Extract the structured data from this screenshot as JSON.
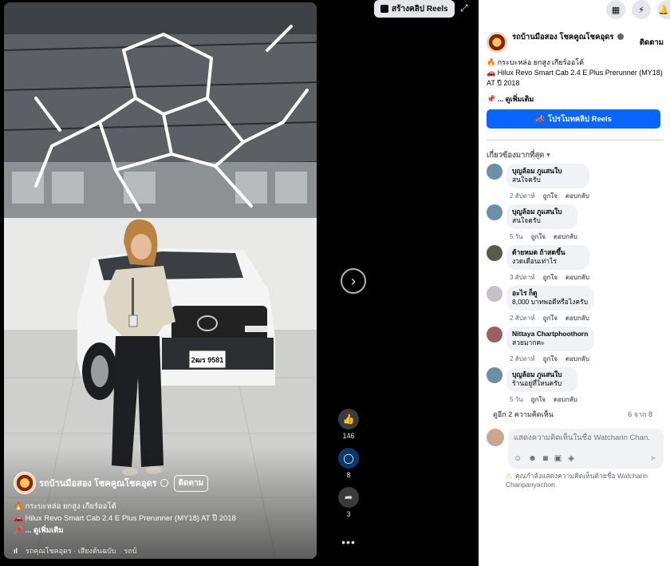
{
  "viewer": {
    "create_reels_label": "สร้างคลิป Reels",
    "video": {
      "author_name": "รถบ้านมือสอง โชคคูณโชคอุดร",
      "follow_label": "ติดตาม",
      "caption_line1": "🔥 กระบะหล่อ ยกสูง เกียร์ออโต้",
      "caption_line2": "🚗 Hilux Revo Smart Cab 2.4 E Plus Prerunner (MY18) AT ปี 2018",
      "see_more": "📌 ... ดูเพิ่มเติม",
      "audio_text": "รถคุณโชคอุดร · เสียงต้นฉบับ",
      "audio_tail": "รถบ้",
      "plate_text": "2ฒร 9581"
    },
    "actions": {
      "likes": "146",
      "comments": "8",
      "shares": "3"
    }
  },
  "panel": {
    "page_name": "รถบ้านมือสอง โชคคูณโชคอุดร",
    "follow_label": "ติดตาม",
    "desc_line1": "🔥 กระบะหล่อ ยกสูง เกียร์ออโต้",
    "desc_line2": "🚗 Hilux Revo Smart Cab 2.4 E Plus Prerunner (MY18) AT ปี 2018",
    "see_more": "📌 ... ดูเพิ่มเติม",
    "promote_label": "โปรโมทคลิป Reels",
    "sort_label": "เกี่ยวข้องมากที่สุด",
    "comments": [
      {
        "author": "บุญล้อม ภูแสนใบ",
        "text": "สนใจครับ",
        "time": "2 สัปดาห์",
        "like": "ถูกใจ",
        "reply": "ตอบกลับ",
        "avatar_color": "#6b8fa8"
      },
      {
        "author": "บุญล้อม ภูแสนใบ",
        "text": "สนใจครับ",
        "time": "5 วัน",
        "like": "ถูกใจ",
        "reply": "ตอบกลับ",
        "avatar_color": "#6b8fa8"
      },
      {
        "author": "ด้ายหมด ถ้าสดขึ้น",
        "text": "งวดเดือนเท่าไร",
        "time": "3 สัปดาห์",
        "like": "ถูกใจ",
        "reply": "ตอบกลับ",
        "avatar_color": "#5a5a4a"
      },
      {
        "author": "อะไร ก็ดู",
        "text": "8,000 บาทพอดีหรือไงครับ",
        "time": "2 สัปดาห์",
        "like": "ถูกใจ",
        "reply": "ตอบกลับ",
        "avatar_color": "#c7c0c8"
      },
      {
        "author": "Nittaya Chartphoothorn",
        "text": "สวยมากคะ",
        "time": "2 สัปดาห์",
        "like": "ถูกใจ",
        "reply": "ตอบกลับ",
        "avatar_color": "#9b5f62"
      },
      {
        "author": "บุญล้อม ภูแสนใบ",
        "text": "ร้านอยู่ที่ไหนครับ",
        "time": "5 วัน",
        "like": "ถูกใจ",
        "reply": "ตอบกลับ",
        "avatar_color": "#6b8fa8"
      }
    ],
    "more_comments": "ดูอีก 2 ความคิดเห็น",
    "comment_count": "6 จาก 8",
    "input_placeholder": "แสดงความคิดเห็นในชื่อ Watcharin Chan...",
    "warning": "คุณกำลังแสดงความคิดเห็นด้วยชื่อ Watcharin Chanpanyachon"
  },
  "colors": {
    "brand_blue": "#0866ff",
    "comment_bubble": "#f0f2f5"
  }
}
